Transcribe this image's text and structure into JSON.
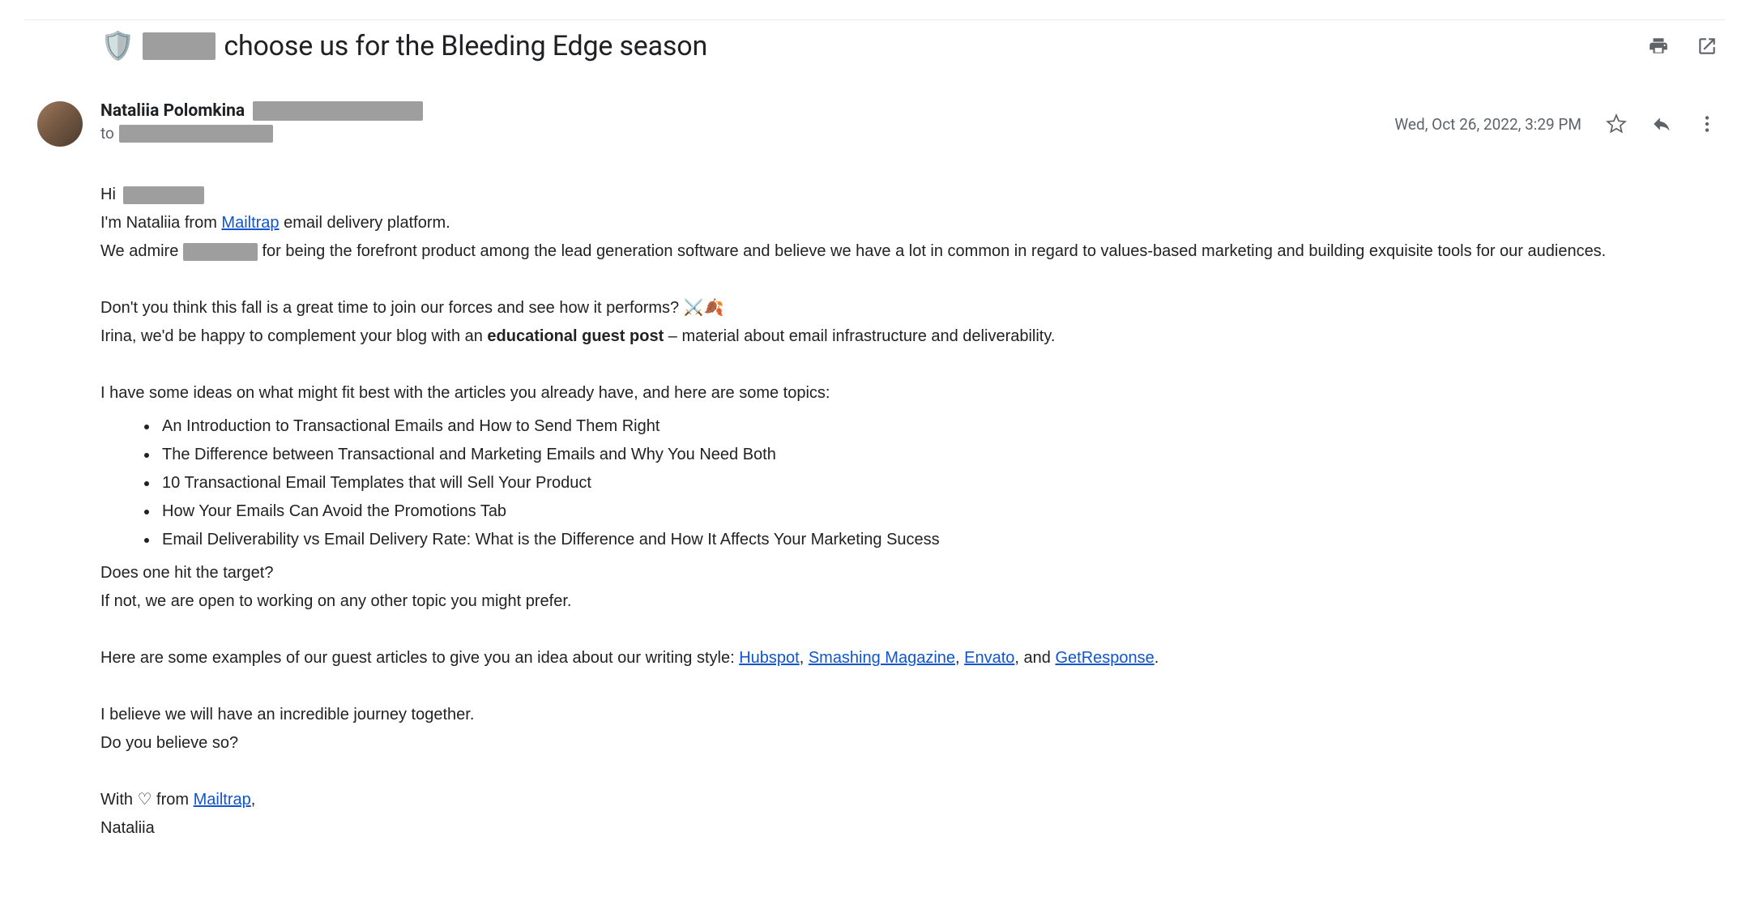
{
  "subject": {
    "shield_emoji": "🛡️",
    "suffix": "choose us for the Bleeding Edge season"
  },
  "sender": {
    "name": "Nataliia Polomkina",
    "to_label": "to"
  },
  "meta": {
    "timestamp": "Wed, Oct 26, 2022, 3:29 PM"
  },
  "body": {
    "hi": "Hi",
    "intro_prefix": "I'm Nataliia from ",
    "intro_link": "Mailtrap",
    "intro_suffix": " email delivery platform.",
    "admire_prefix": "We admire ",
    "admire_suffix": " for being the forefront product among the lead generation software and believe we have a lot in common in regard to values-based marketing and building exquisite tools for our audiences.",
    "forces_line": "Don't you think this fall is a great time to join our forces and see how it performs? ",
    "forces_emoji": "⚔️🍂",
    "irina_prefix": "Irina, we'd be happy to complement your blog with an ",
    "irina_bold": "educational guest post",
    "irina_suffix": " – material about email infrastructure and deliverability.",
    "ideas_intro": "I have some ideas on what might fit best with the articles you already have, and here are some topics:",
    "topics": [
      "An Introduction to Transactional Emails and How to Send Them Right",
      "The Difference between Transactional and Marketing Emails and Why You Need Both",
      "10 Transactional Email Templates that will Sell Your Product",
      "How Your Emails Can Avoid the Promotions Tab",
      "Email Deliverability vs Email Delivery Rate: What is the Difference and How It Affects Your Marketing Sucess"
    ],
    "hit_target": "Does one hit the target?",
    "if_not": "If not, we are open to working on any other topic you might prefer.",
    "examples_prefix": "Here are some examples of our guest articles to give you an idea about our writing style: ",
    "examples_links": [
      "Hubspot",
      "Smashing Magazine",
      "Envato",
      "GetResponse"
    ],
    "examples_and": ", and ",
    "examples_end": ".",
    "journey": "I believe we will have an incredible journey together.",
    "believe": "Do you believe so?",
    "sig_prefix": "With ",
    "sig_heart": "♡",
    "sig_mid": " from ",
    "sig_link": "Mailtrap",
    "sig_end": ",",
    "signature_name": "Nataliia"
  }
}
